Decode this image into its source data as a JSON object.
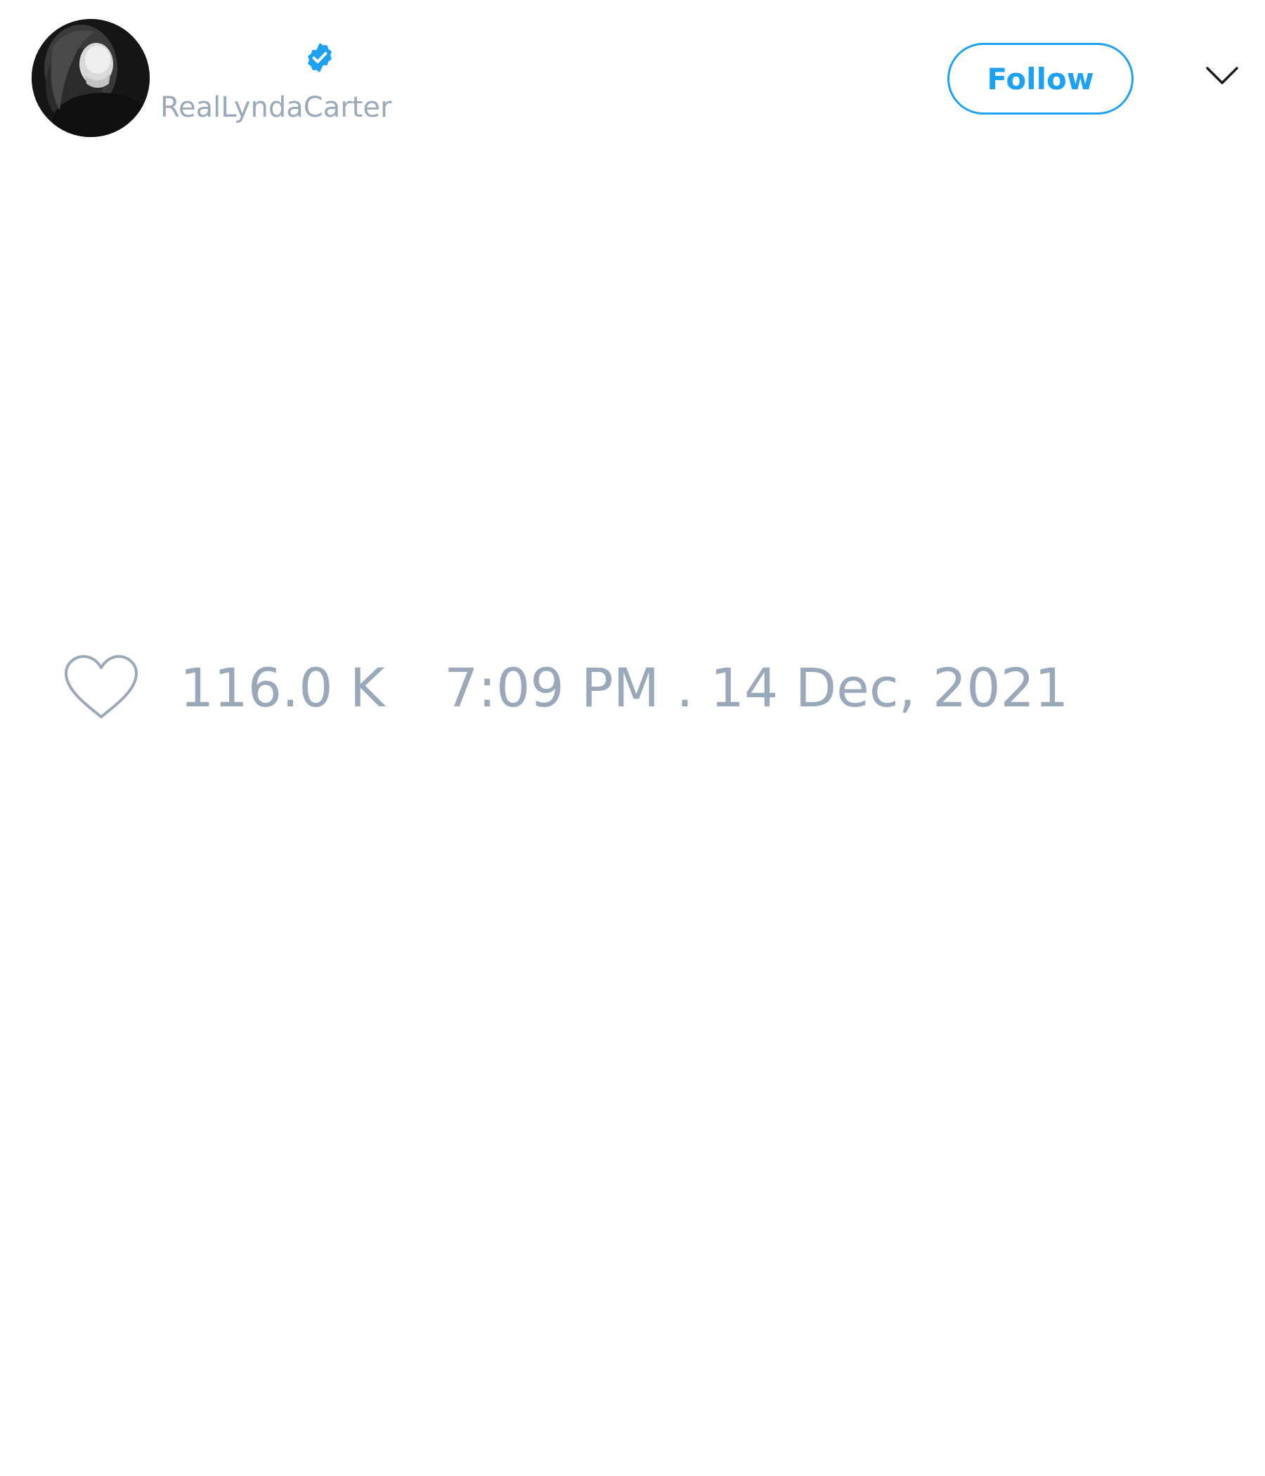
{
  "user": {
    "handle": "RealLyndaCarter",
    "verified_icon": "verified-badge-icon",
    "avatar_icon": "profile-photo"
  },
  "header": {
    "follow_label": "Follow",
    "menu_icon": "chevron-down-icon"
  },
  "tweet": {
    "like_icon": "heart-icon",
    "like_count": "116.0 K",
    "timestamp": "7:09 PM . 14 Dec, 2021"
  },
  "colors": {
    "accent": "#1da1f2",
    "muted_text": "#9aa9ba",
    "background": "#ffffff"
  }
}
